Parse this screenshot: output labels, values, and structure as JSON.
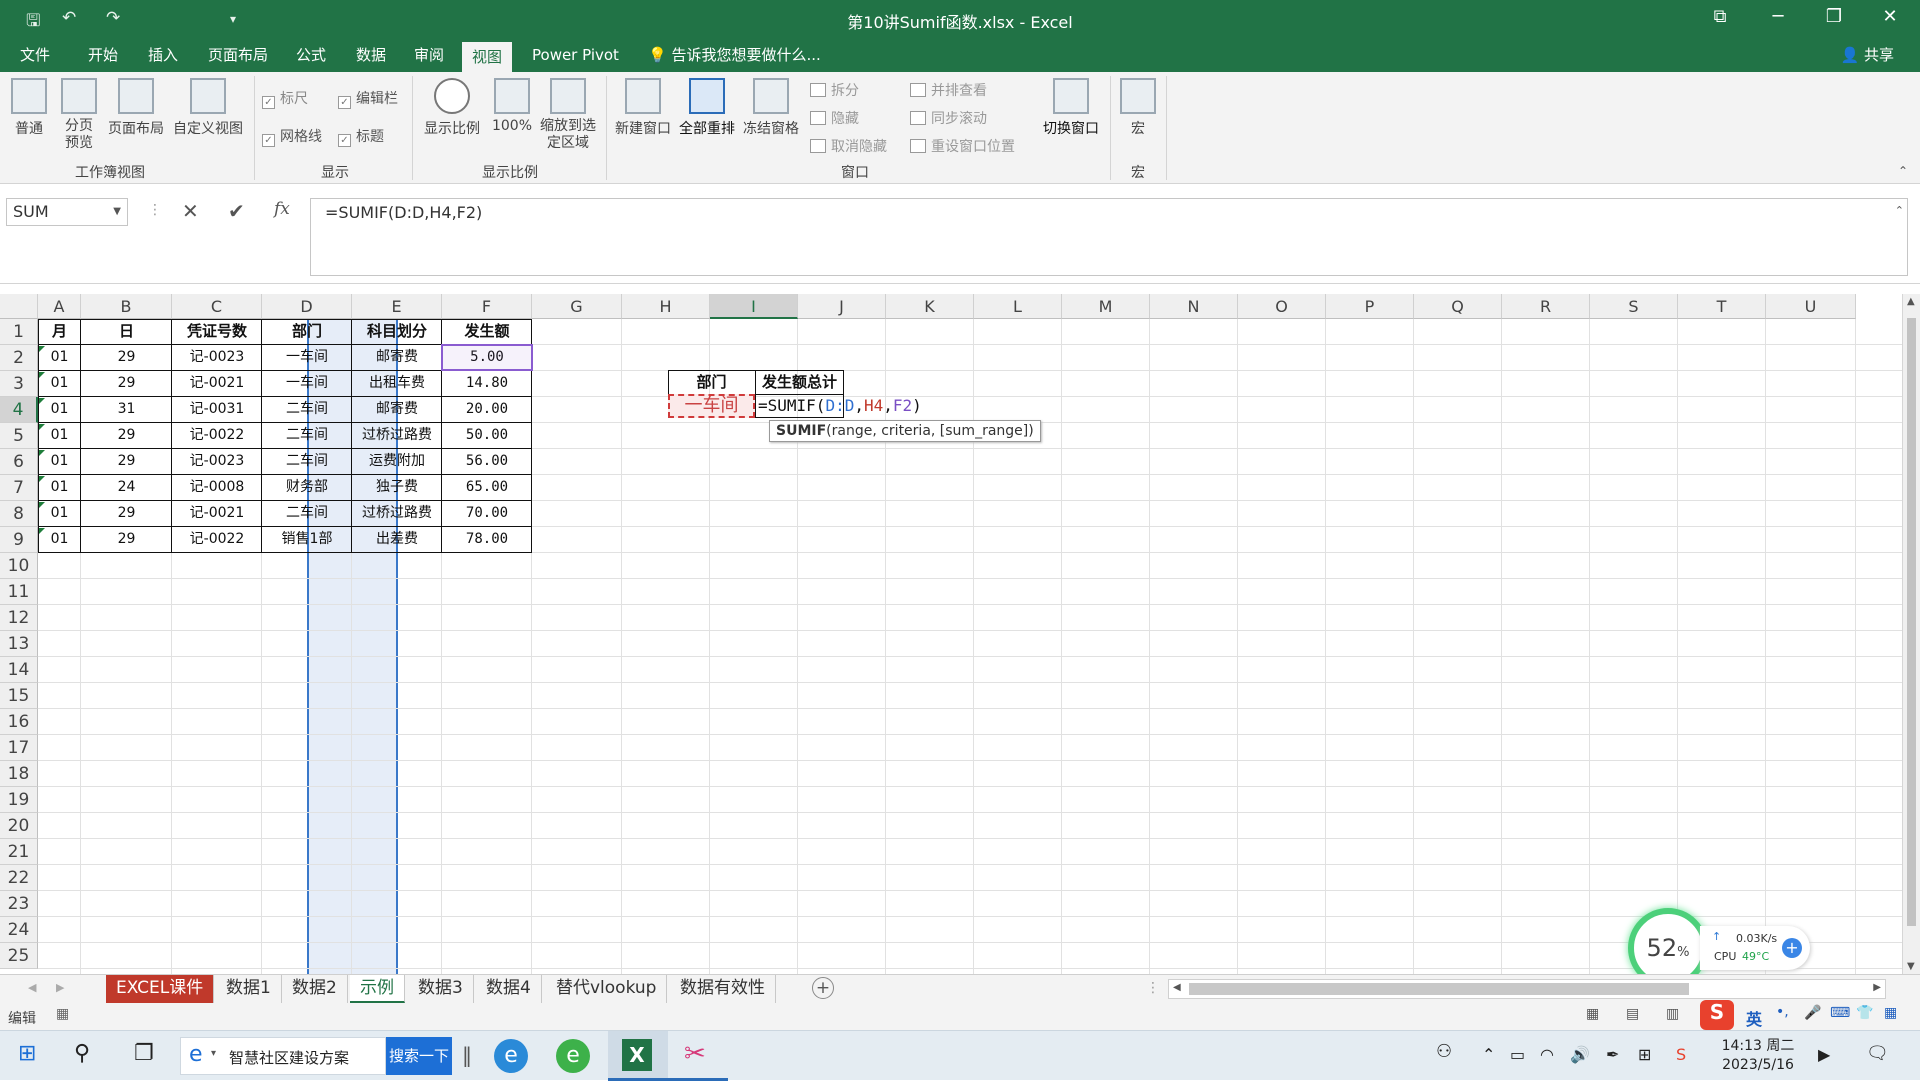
{
  "window": {
    "title": "第10讲Sumif函数.xlsx - Excel",
    "min": "─",
    "restore": "❐",
    "close": "✕"
  },
  "quick_access": {
    "save": "🖫",
    "undo": "↶",
    "redo": "↷",
    "more": "▾"
  },
  "tabs": [
    "文件",
    "开始",
    "插入",
    "页面布局",
    "公式",
    "数据",
    "审阅",
    "视图",
    "Power Pivot"
  ],
  "active_tab": "视图",
  "tell_me": "告诉我您想要做什么...",
  "share": "共享",
  "ribbon": {
    "workbook_views": {
      "normal": "普通",
      "page_break": "分页预览",
      "page_layout": "页面布局",
      "custom": "自定义视图",
      "group": "工作簿视图"
    },
    "show": {
      "ruler": "标尺",
      "formula_bar": "编辑栏",
      "gridlines": "网格线",
      "headings": "标题",
      "group": "显示"
    },
    "zoom": {
      "zoom": "显示比例",
      "z100": "100%",
      "to_sel": "缩放到选定区域",
      "group": "显示比例"
    },
    "window": {
      "new_window": "新建窗口",
      "arrange_all": "全部重排",
      "freeze": "冻结窗格",
      "split": "拆分",
      "hide": "隐藏",
      "unhide": "取消隐藏",
      "side_by_side": "并排查看",
      "sync_scroll": "同步滚动",
      "reset_pos": "重设窗口位置",
      "switch": "切换窗口",
      "group": "窗口"
    },
    "macros": {
      "macro": "宏",
      "group": "宏"
    }
  },
  "formula_bar": {
    "name_box": "SUM",
    "cancel": "✕",
    "enter": "✔",
    "fx": "fx",
    "formula": "=SUMIF(D:D,H4,F2)"
  },
  "columns": [
    "A",
    "B",
    "C",
    "D",
    "E",
    "F",
    "G",
    "H",
    "I",
    "J",
    "K",
    "L",
    "M",
    "N",
    "O",
    "P",
    "Q",
    "R",
    "S",
    "T",
    "U"
  ],
  "rows": [
    "1",
    "2",
    "3",
    "4",
    "5",
    "6",
    "7",
    "8",
    "9",
    "10",
    "11",
    "12",
    "13",
    "14",
    "15",
    "16",
    "17",
    "18",
    "19",
    "20",
    "21",
    "22",
    "23",
    "24",
    "25"
  ],
  "table": {
    "headers": [
      "月",
      "日",
      "凭证号数",
      "部门",
      "科目划分",
      "发生额"
    ],
    "rows": [
      [
        "01",
        "29",
        "记-0023",
        "一车间",
        "邮寄费",
        "5.00"
      ],
      [
        "01",
        "29",
        "记-0021",
        "一车间",
        "出租车费",
        "14.80"
      ],
      [
        "01",
        "31",
        "记-0031",
        "二车间",
        "邮寄费",
        "20.00"
      ],
      [
        "01",
        "29",
        "记-0022",
        "二车间",
        "过桥过路费",
        "50.00"
      ],
      [
        "01",
        "29",
        "记-0023",
        "二车间",
        "运费附加",
        "56.00"
      ],
      [
        "01",
        "24",
        "记-0008",
        "财务部",
        "独子费",
        "65.00"
      ],
      [
        "01",
        "29",
        "记-0021",
        "二车间",
        "过桥过路费",
        "70.00"
      ],
      [
        "01",
        "29",
        "记-0022",
        "销售1部",
        "出差费",
        "78.00"
      ]
    ]
  },
  "summary": {
    "dept_header": "部门",
    "total_header": "发生额总计",
    "dept_value": "一车间",
    "editing": {
      "prefix": "=SUMIF(",
      "arg1": "D:D",
      "arg2": "H4",
      "arg3": "F2",
      "suffix": ")"
    }
  },
  "tooltip": {
    "fn": "SUMIF",
    "args": "(range, criteria, [sum_range])"
  },
  "sheets": [
    "EXCEL课件",
    "数据1",
    "数据2",
    "示例",
    "数据3",
    "数据4",
    "替代vlookup",
    "数据有效性"
  ],
  "active_sheet": "示例",
  "status": {
    "mode": "编辑"
  },
  "monitor": {
    "pct": "52",
    "unit": "%",
    "net": "0.03K/s",
    "cpu": "CPU",
    "temp": "49°C"
  },
  "taskbar": {
    "search_text": "智慧社区建设方案",
    "search_btn": "搜索一下",
    "time": "14:13 周二",
    "date": "2023/5/16",
    "ime": "英"
  },
  "colors": {
    "excel_green": "#217346",
    "sheet_red": "#c0392b",
    "col_d_sel": "#e6edf8"
  }
}
